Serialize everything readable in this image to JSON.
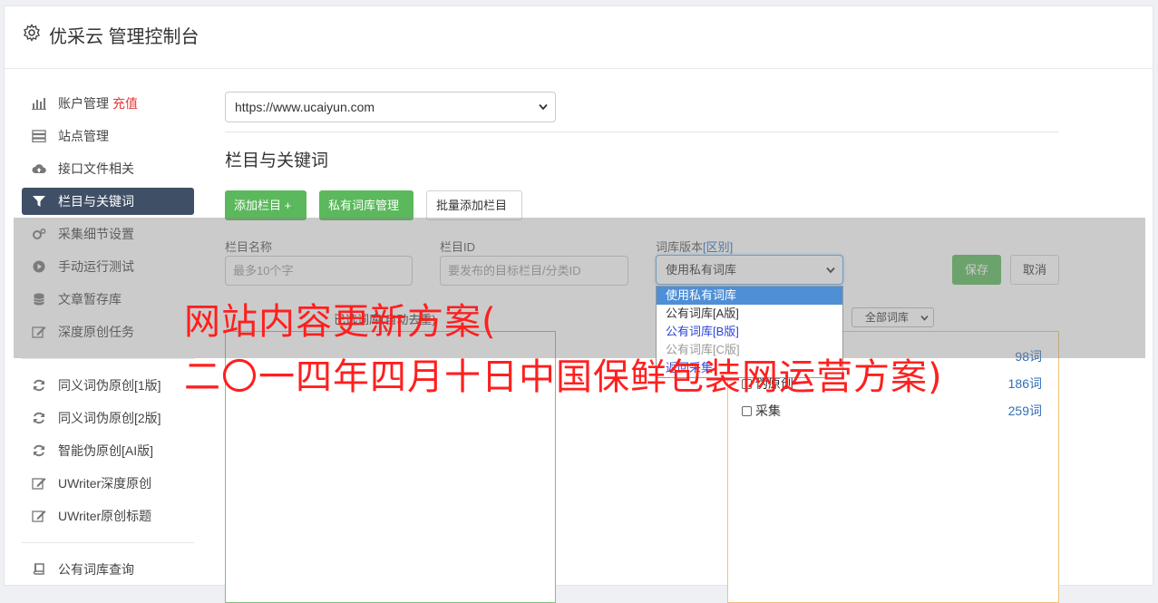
{
  "app": {
    "title": "优采云 管理控制台",
    "icon": "gear-icon"
  },
  "sidebar": {
    "items": [
      {
        "label": "账户管理",
        "extra": "充值",
        "icon": "bar-chart-icon"
      },
      {
        "label": "站点管理",
        "icon": "server-icon"
      },
      {
        "label": "接口文件相关",
        "icon": "cloud-upload-icon"
      },
      {
        "label": "栏目与关键词",
        "icon": "filter-icon",
        "active": true
      },
      {
        "label": "采集细节设置",
        "icon": "cogs-icon"
      },
      {
        "label": "手动运行测试",
        "icon": "play-icon"
      },
      {
        "label": "文章暂存库",
        "icon": "database-icon"
      },
      {
        "label": "深度原创任务",
        "icon": "edit-icon"
      },
      {
        "label": "同义词伪原创[1版]",
        "icon": "refresh-icon"
      },
      {
        "label": "同义词伪原创[2版]",
        "icon": "refresh-icon"
      },
      {
        "label": "智能伪原创[AI版]",
        "icon": "refresh-icon"
      },
      {
        "label": "UWriter深度原创",
        "icon": "edit-icon"
      },
      {
        "label": "UWriter原创标题",
        "icon": "edit-icon"
      },
      {
        "label": "公有词库查询",
        "icon": "book-icon"
      }
    ]
  },
  "main": {
    "site_select": "https://www.ucaiyun.com",
    "section_title": "栏目与关键词",
    "buttons": {
      "add_column": "添加栏目 +",
      "private_lib": "私有词库管理",
      "batch_add": "批量添加栏目"
    },
    "form": {
      "name_label": "栏目名称",
      "name_placeholder": "最多10个字",
      "id_label": "栏目ID",
      "id_placeholder": "要发布的目标栏目/分类ID",
      "version_label": "词库版本",
      "version_link": "[区别]",
      "version_value": "使用私有词库",
      "save": "保存",
      "cancel": "取消"
    },
    "dropdown_options": [
      {
        "label": "使用私有词库",
        "state": "selected"
      },
      {
        "label": "公有词库[A版]",
        "state": "normal"
      },
      {
        "label": "公有词库[B版]",
        "state": "blue"
      },
      {
        "label": "公有词库[C版]",
        "state": "faded"
      },
      {
        "label": "返回采集",
        "state": "link"
      }
    ],
    "left_panel_title": "已选词库(自动去重)",
    "filter_select": "全部词库",
    "libraries": [
      {
        "label": "",
        "count": "98词"
      },
      {
        "label": "伪原创",
        "count": "186词"
      },
      {
        "label": "采集",
        "count": "259词"
      }
    ]
  },
  "watermark": {
    "line1": "网站内容更新方案(",
    "line2": "二〇一四年四月十日中国保鲜包装网运营方案)",
    "color": "#ff1f1f"
  }
}
